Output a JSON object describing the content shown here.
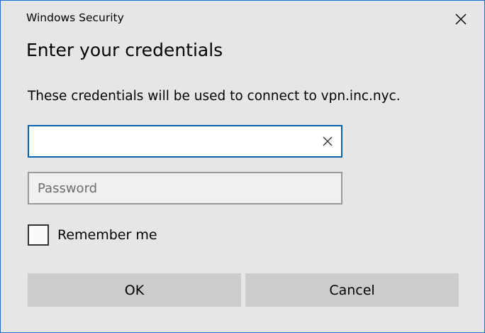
{
  "window": {
    "title": "Windows Security",
    "accent_color": "#1a6fd0"
  },
  "dialog": {
    "heading": "Enter your credentials",
    "description": "These credentials will be used to connect to vpn.inc.nyc."
  },
  "username": {
    "value": "",
    "placeholder": "",
    "focus_color": "#0063b1"
  },
  "password": {
    "value": "",
    "placeholder": "Password"
  },
  "remember": {
    "label": "Remember me",
    "checked": false
  },
  "buttons": {
    "ok": "OK",
    "cancel": "Cancel"
  },
  "icons": {
    "close": "close-icon",
    "clear": "clear-icon"
  }
}
